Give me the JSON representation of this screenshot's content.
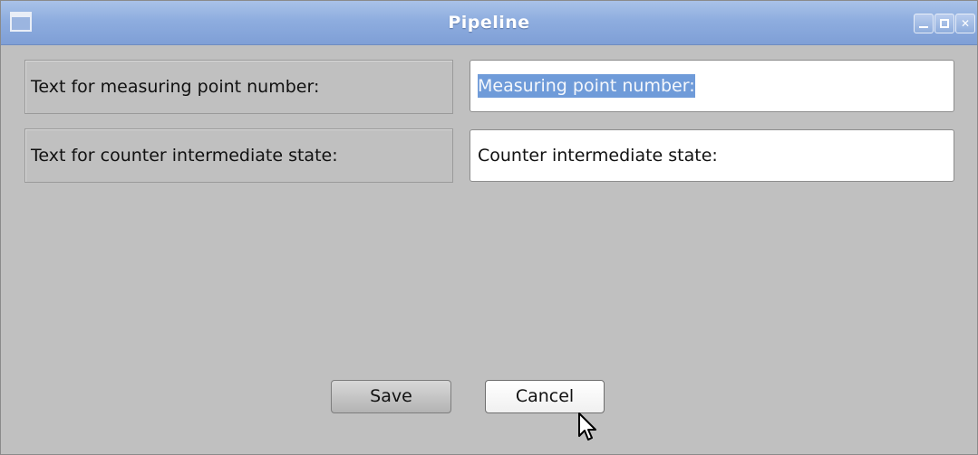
{
  "window": {
    "title": "Pipeline"
  },
  "form": {
    "measuring_point_label": "Text for measuring point number:",
    "measuring_point_value": "Measuring point number:",
    "counter_state_label": "Text for counter intermediate state:",
    "counter_state_value": "Counter intermediate state:"
  },
  "buttons": {
    "save": "Save",
    "cancel": "Cancel"
  },
  "icons": {
    "window": "window-icon",
    "minimize": "minimize-icon",
    "maximize": "maximize-icon",
    "close": "close-icon",
    "cursor": "mouse-pointer-icon"
  },
  "colors": {
    "titlebar": "#8eaddf",
    "background": "#c0c0c0",
    "selection": "#6f9bd9"
  }
}
